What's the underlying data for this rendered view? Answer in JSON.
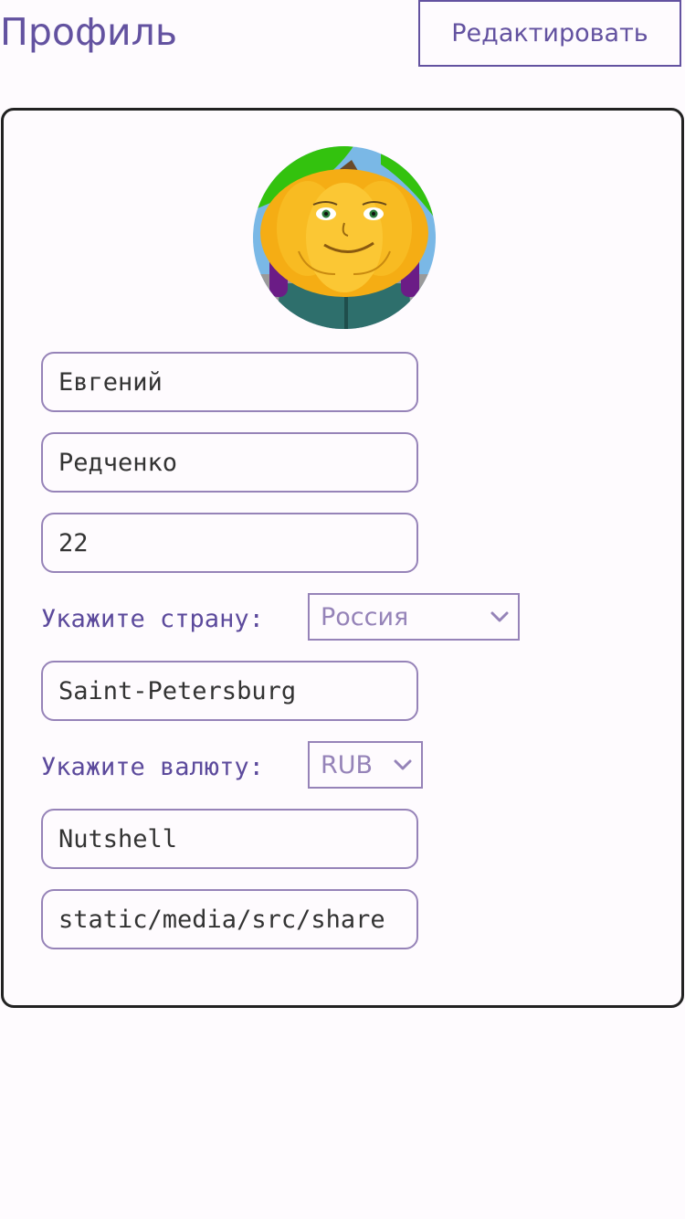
{
  "header": {
    "title": "Профиль",
    "edit_label": "Редактировать"
  },
  "profile": {
    "avatar_icon": "pumpkin-avatar",
    "first_name": "Евгений",
    "last_name": "Редченко",
    "age": "22",
    "country_label": "Укажите страну:",
    "country_value": "Россия",
    "city": "Saint-Petersburg",
    "currency_label": "Укажите валюту:",
    "currency_value": "RUB",
    "company": "Nutshell",
    "avatar_path": "static/media/src/share"
  },
  "colors": {
    "accent": "#6352a0",
    "border": "#9683b8",
    "card_border": "#222222",
    "background": "#fefbfe"
  }
}
